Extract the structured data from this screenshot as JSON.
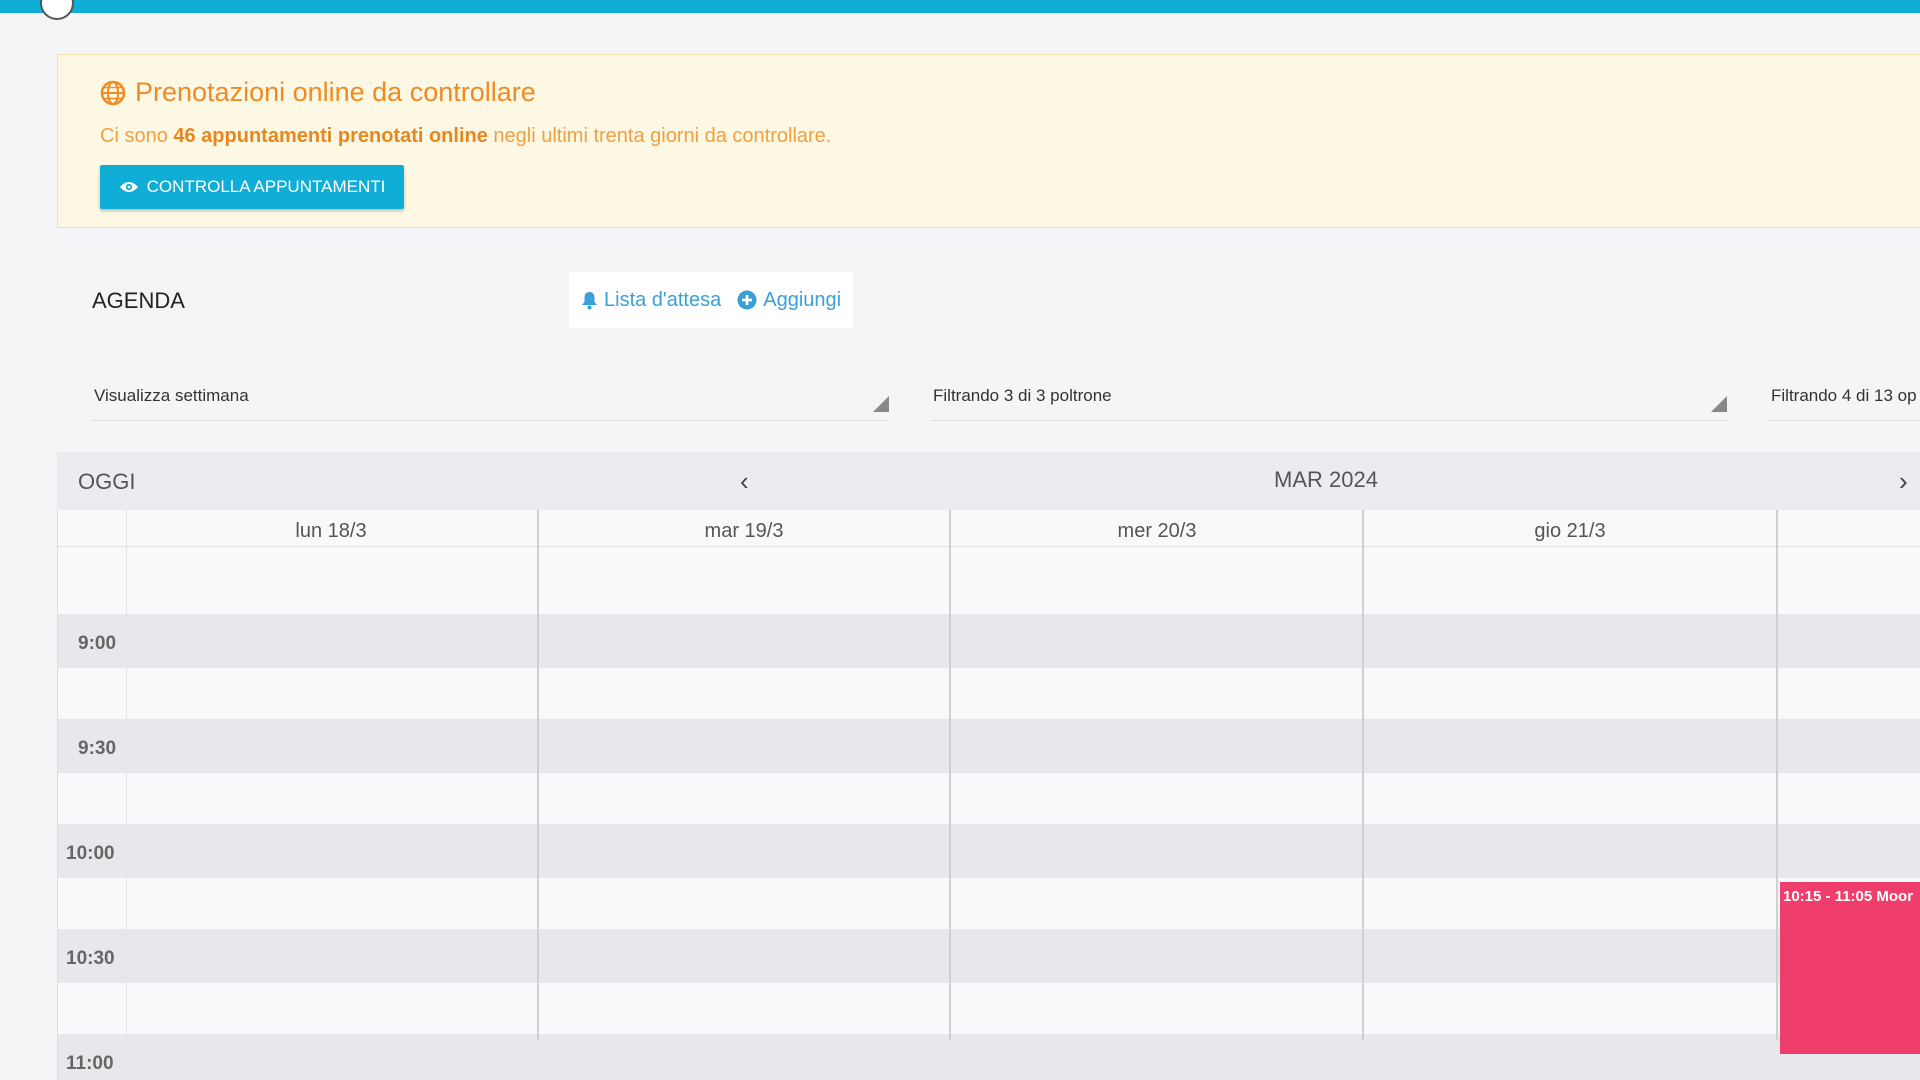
{
  "alert": {
    "title": "Prenotazioni online da controllare",
    "text_before": "Ci sono ",
    "text_bold": "46 appuntamenti prenotati online",
    "text_after": " negli ultimi trenta giorni da controllare.",
    "button_label": "CONTROLLA APPUNTAMENTI",
    "accent_color": "#f08a24",
    "icon": "globe-icon"
  },
  "agenda": {
    "title": "AGENDA",
    "waitlist_label": "Lista d'attesa",
    "add_label": "Aggiungi"
  },
  "filters": {
    "view": "Visualizza settimana",
    "chairs": "Filtrando 3 di 3 poltrone",
    "operators": "Filtrando 4 di 13 op"
  },
  "calendar": {
    "today_label": "OGGI",
    "month_label": "MAR 2024",
    "days": [
      "lun 18/3",
      "mar 19/3",
      "mer 20/3",
      "gio 21/3"
    ],
    "times": [
      "9:00",
      "9:30",
      "10:00",
      "10:30",
      "11:00"
    ],
    "event": {
      "label": "10:15 - 11:05 Moor",
      "color": "#f03e6c"
    }
  },
  "colors": {
    "primary": "#10aed6",
    "link": "#3aa0d8"
  }
}
